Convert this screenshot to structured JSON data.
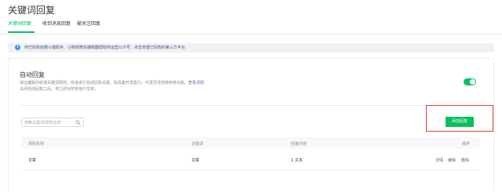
{
  "page": {
    "title": "关键词回复"
  },
  "tabs": [
    {
      "label": "关键词回复",
      "active": true
    },
    {
      "label": "收到消息回复",
      "active": false
    },
    {
      "label": "被关注回复",
      "active": false
    }
  ],
  "notice": {
    "icon": "info-icon",
    "text": "你已授权给微小值助手、小鹅校微信编辑器帮助你运营公众号，点击管理已授权的第三方平台"
  },
  "auto_reply": {
    "title": "自动回复",
    "desc_line1": "通过编辑内容或关键词规则，快速进行自动回复设置。如具备开发能力，可更灵活地使用该功能。",
    "desc_link": "查看详情",
    "desc_line2": "关闭自动回复之后，将立即对所有用户生效。",
    "enabled": true
  },
  "search": {
    "placeholder": "搜索关键词/规则名称",
    "value": ""
  },
  "add_button": {
    "label": "添加回复"
  },
  "table": {
    "columns": [
      "规则名称",
      "关键词",
      "回复内容",
      "操作"
    ],
    "rows": [
      {
        "name": "文章",
        "keyword": "文章",
        "content": "1 文本",
        "actions": [
          "详情",
          "编辑",
          "删除"
        ]
      }
    ]
  },
  "colors": {
    "accent": "#07c160",
    "link": "#576b95",
    "highlight": "#e0403a",
    "notice_bg": "#eef2f7"
  }
}
